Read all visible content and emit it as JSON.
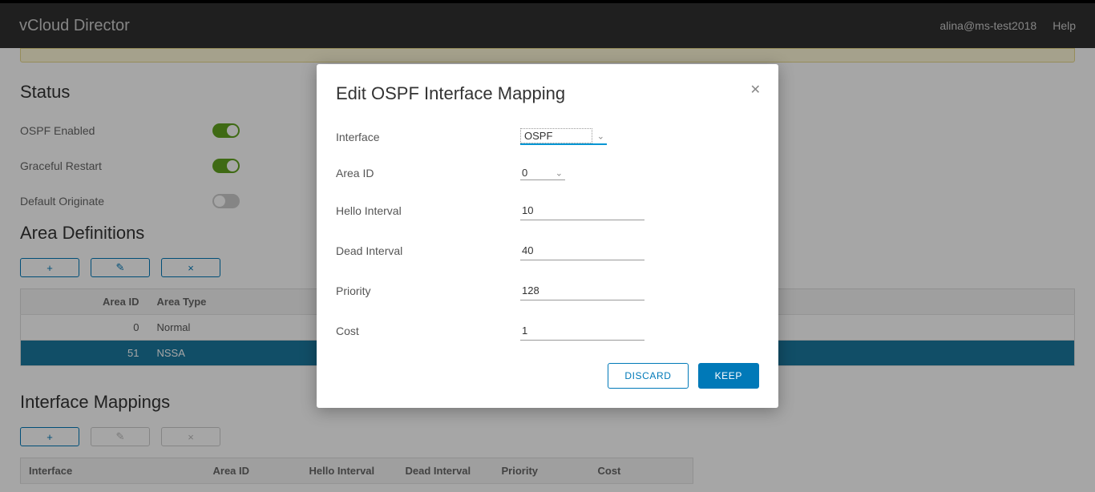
{
  "header": {
    "app_title": "vCloud Director",
    "user": "alina@ms-test2018",
    "help": "Help"
  },
  "status": {
    "title": "Status",
    "ospf_enabled_label": "OSPF Enabled",
    "ospf_enabled": true,
    "graceful_restart_label": "Graceful Restart",
    "graceful_restart": true,
    "default_originate_label": "Default Originate",
    "default_originate": false
  },
  "area_defs": {
    "title": "Area Definitions",
    "headers": {
      "area_id": "Area ID",
      "area_type": "Area Type"
    },
    "rows": [
      {
        "area_id": "0",
        "area_type": "Normal",
        "selected": false
      },
      {
        "area_id": "51",
        "area_type": "NSSA",
        "selected": true
      }
    ],
    "icons": {
      "add": "+",
      "edit": "✎",
      "delete": "×"
    }
  },
  "iface_map": {
    "title": "Interface Mappings",
    "headers": {
      "interface": "Interface",
      "area_id": "Area ID",
      "hello": "Hello Interval",
      "dead": "Dead Interval",
      "priority": "Priority",
      "cost": "Cost"
    },
    "icons": {
      "add": "+",
      "edit": "✎",
      "delete": "×"
    }
  },
  "modal": {
    "title": "Edit OSPF Interface Mapping",
    "labels": {
      "interface": "Interface",
      "area_id": "Area ID",
      "hello": "Hello Interval",
      "dead": "Dead Interval",
      "priority": "Priority",
      "cost": "Cost"
    },
    "values": {
      "interface": "OSPF",
      "area_id": "0",
      "hello": "10",
      "dead": "40",
      "priority": "128",
      "cost": "1"
    },
    "buttons": {
      "discard": "DISCARD",
      "keep": "KEEP"
    }
  }
}
